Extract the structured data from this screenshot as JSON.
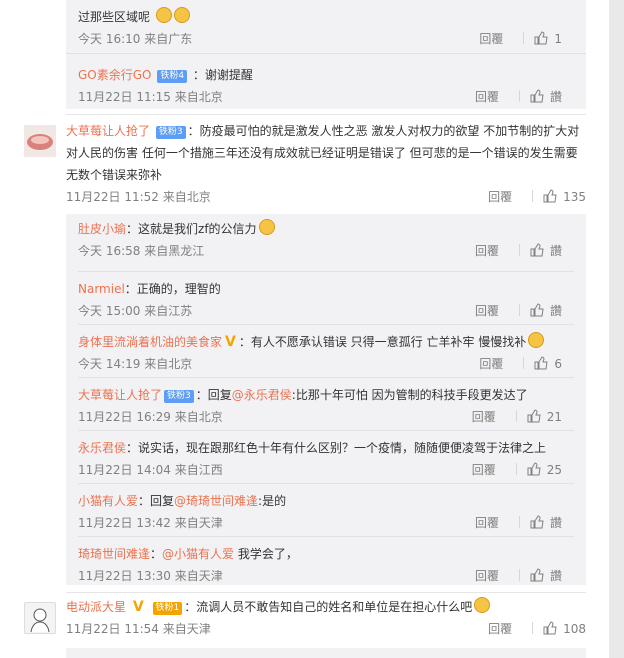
{
  "sub1": {
    "text": "过那些区域呢",
    "time": "今天 16:10 来自广东",
    "reply": "回覆",
    "likes": "1"
  },
  "sub2": {
    "name": "GO素余行GO",
    "badge": "铁粉4",
    "text": "：谢谢提醒",
    "time": "11月22日 11:15 来自北京",
    "reply": "回覆",
    "likes": "讚"
  },
  "c1": {
    "name": "大草莓让人抢了",
    "badge": "铁粉3",
    "text": "：防疫最可怕的就是激发人性之恶 激发人对权力的欲望 不加节制的扩大对对人民的伤害 任何一个措施三年还没有成效就已经证明是错误了 但可悲的是一个错误的发生需要无数个错误来弥补",
    "time": "11月22日 11:52 来自北京",
    "reply": "回覆",
    "likes": "135",
    "replies": [
      {
        "name": "肚皮小瑜",
        "text": "：这就是我们zf的公信力",
        "time": "今天 16:58 来自黑龙江",
        "reply": "回覆",
        "likes": "讚"
      },
      {
        "name": "Narmiel",
        "text": "：正确的，理智的",
        "time": "今天 15:00 来自江苏",
        "reply": "回覆",
        "likes": "讚"
      },
      {
        "name": "身体里流淌着机油的美食家",
        "text": "：有人不愿承认错误 只得一意孤行 亡羊补牢 慢慢找补",
        "time": "今天 14:19 来自北京",
        "reply": "回覆",
        "likes": "6"
      },
      {
        "name": "大草莓让人抢了",
        "badge": "铁粉3",
        "text": "：回复",
        "mention": "@永乐君侯",
        "text2": ":比那十年可怕 因为管制的科技手段更发达了",
        "time": "11月22日 16:29 来自北京",
        "reply": "回覆",
        "likes": "21"
      },
      {
        "name": "永乐君侯",
        "text": "：说实话，现在跟那红色十年有什么区别？一个疫情，随随便便凌驾于法律之上",
        "time": "11月22日 14:04 来自江西",
        "reply": "回覆",
        "likes": "25"
      },
      {
        "name": "小猫有人爱",
        "text": "：回复",
        "mention": "@琦琦世间难逢",
        "text2": ":是的",
        "time": "11月22日 13:42 来自天津",
        "reply": "回覆",
        "likes": "讚"
      },
      {
        "name": "琦琦世间难逢",
        "text": "：",
        "mention": "@小猫有人爱",
        "text2": " 我学会了，",
        "time": "11月22日 13:30 来自天津",
        "reply": "回覆",
        "likes": "讚"
      }
    ]
  },
  "c2": {
    "name": "电动派大星",
    "badge": "铁粉1",
    "text": "：流调人员不敢告知自己的姓名和单位是在担心什么吧",
    "time": "11月22日 11:54 来自天津",
    "reply": "回覆",
    "likes": "108"
  }
}
